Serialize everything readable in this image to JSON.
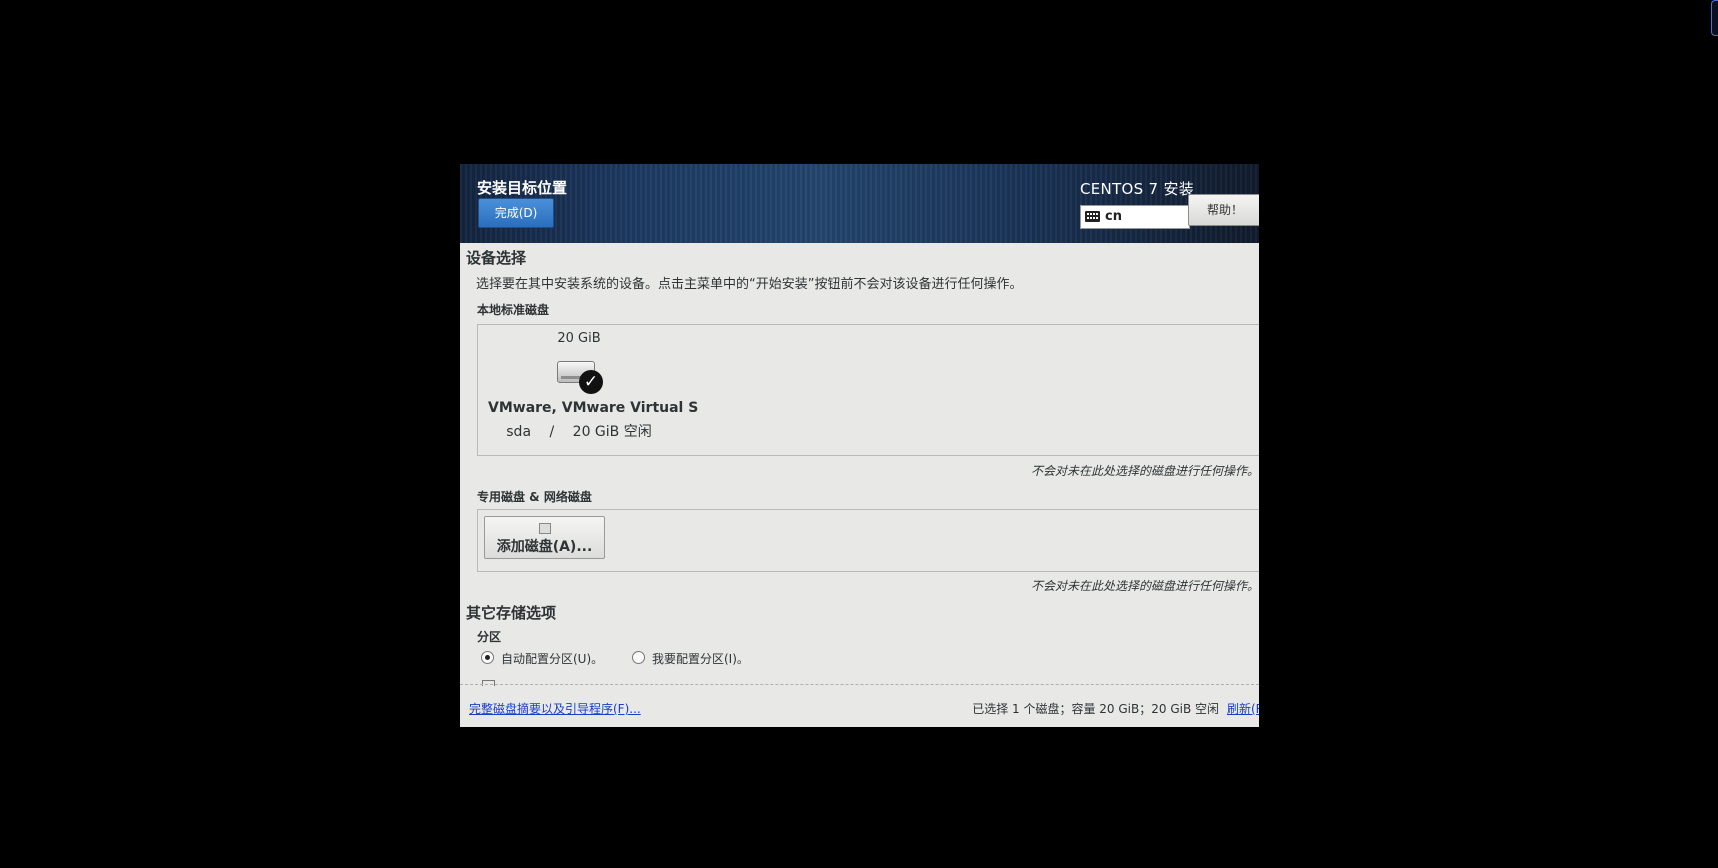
{
  "header": {
    "spoke_title": "安装目标位置",
    "done_button": "完成(D)",
    "product_title": "CENTOS 7 安装",
    "keyboard_layout": "cn",
    "help_button": "帮助！"
  },
  "device_selection": {
    "title": "设备选择",
    "description": "选择要在其中安装系统的设备。点击主菜单中的“开始安装”按钮前不会对该设备进行任何操作。",
    "local_disks_label": "本地标准磁盘",
    "disk": {
      "size": "20 GiB",
      "name": "VMware, VMware Virtual S",
      "device": "sda",
      "separator": "/",
      "free": "20 GiB 空闲",
      "selected": true
    },
    "local_note": "不会对未在此处选择的磁盘进行任何操作。",
    "specialized_label": "专用磁盘 & 网络磁盘",
    "add_disk_button": "添加磁盘(A)...",
    "specialized_note": "不会对未在此处选择的磁盘进行任何操作。"
  },
  "other_storage": {
    "title": "其它存储选项",
    "partition_label": "分区",
    "auto_partition": "自动配置分区(U)。",
    "manual_partition": "我要配置分区(I)。",
    "auto_selected": true
  },
  "footer": {
    "summary_link": "完整磁盘摘要以及引导程序(F)...",
    "summary_text": "已选择 1 个磁盘；容量 20 GiB；20 GiB 空闲",
    "refresh_link": "刷新(R)"
  }
}
